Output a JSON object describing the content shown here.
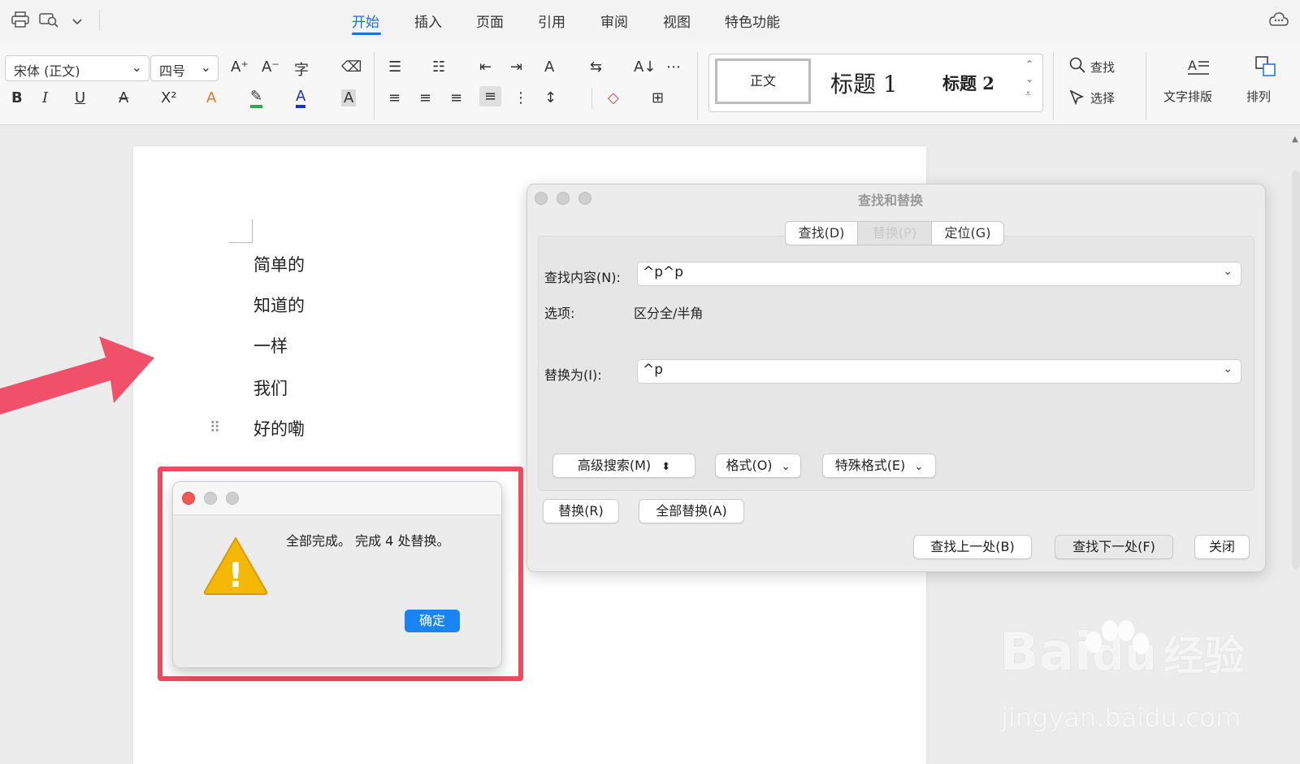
{
  "menubar": {
    "tabs": [
      "开始",
      "插入",
      "页面",
      "引用",
      "审阅",
      "视图",
      "特色功能"
    ],
    "active_tab": "开始",
    "quick_icons": [
      "print-icon",
      "print-preview-icon",
      "chevron-down-icon"
    ],
    "right_icon": "cloud-chat-icon"
  },
  "ribbon": {
    "font_name": "宋体 (正文)",
    "font_size": "四号",
    "styles": {
      "normal": "正文",
      "heading1": "标题 1",
      "heading2": "标题 2"
    },
    "find_label": "查找",
    "select_label": "选择",
    "text_layout_label": "文字排版",
    "arrange_label": "排列",
    "glyphs": {
      "grow": "A⁺",
      "shrink": "A⁻",
      "phonetic": "字",
      "eraser": "⌫",
      "bold": "B",
      "italic": "I",
      "underline": "U",
      "strike": "A",
      "sup": "X²",
      "effect": "A",
      "highlight": "✎",
      "color": "A",
      "charshade": "A",
      "bullets": "☰",
      "numbering": "☷",
      "outdent": "⇤",
      "indent": "⇥",
      "direction": "A",
      "swap": "⇆",
      "sort": "A↓",
      "distrib": "⋯",
      "left": "≡",
      "center": "≡",
      "right": "≡",
      "justify": "≡",
      "spread": "⋮",
      "spacing": "↕",
      "shading": "◇",
      "borders": "⊞",
      "dropdown": "⌄",
      "find": "⌕",
      "select": "⬀",
      "layout": "A≡",
      "arrange": "⧉"
    }
  },
  "document": {
    "lines": [
      "简单的",
      "知道的",
      "一样",
      "我们",
      "好的嘞"
    ],
    "drag_handle": "⠿"
  },
  "find_replace": {
    "title": "查找和替换",
    "tabs": [
      "查找(D)",
      "替换(P)",
      "定位(G)"
    ],
    "selected_tab": "替换(P)",
    "find_label": "查找内容(N):",
    "find_value": "^p^p",
    "options_label": "选项:",
    "options_value": "区分全/半角",
    "replace_label": "替换为(I):",
    "replace_value": "^p",
    "advanced_search": "高级搜索(M)",
    "format": "格式(O)",
    "special_format": "特殊格式(E)",
    "replace_btn": "替换(R)",
    "replace_all_btn": "全部替换(A)",
    "find_prev_btn": "查找上一处(B)",
    "find_next_btn": "查找下一处(F)",
    "close_btn": "关闭",
    "glyphs": {
      "dropdown": "⌄",
      "updown": "⬍"
    }
  },
  "alert": {
    "message": "全部完成。 完成 4 处替换。",
    "ok": "确定",
    "warning_mark": "!"
  },
  "watermark": {
    "brand": "Bai",
    "brand2": "du",
    "cn": "经验",
    "url": "jingyan.baidu.com"
  },
  "colors": {
    "accent": "#1f6fe0",
    "highlight_border": "#ee4a5e",
    "arrow": "#f0506a",
    "ok_button": "#1a84f5",
    "warning": "#f5b800"
  }
}
